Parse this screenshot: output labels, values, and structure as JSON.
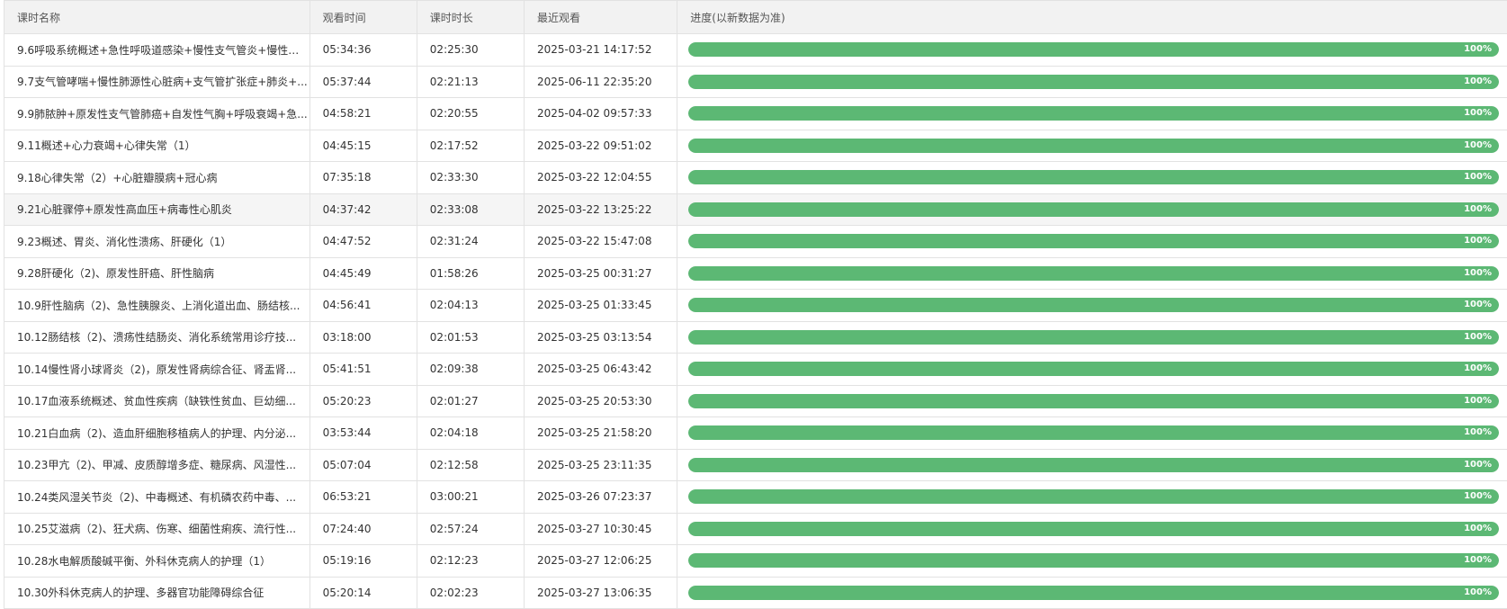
{
  "headers": {
    "name": "课时名称",
    "watch_time": "观看时间",
    "duration": "课时时长",
    "last_watched": "最近观看",
    "progress": "进度(以新数据为准)"
  },
  "colors": {
    "progress_fill": "#5cb874"
  },
  "rows": [
    {
      "name": "9.6呼吸系统概述+急性呼吸道感染+慢性支气管炎+慢性阻...",
      "watch_time": "05:34:36",
      "duration": "02:25:30",
      "last_watched": "2025-03-21 14:17:52",
      "progress": 100,
      "progress_label": "100%"
    },
    {
      "name": "9.7支气管哮喘+慢性肺源性心脏病+支气管扩张症+肺炎+...",
      "watch_time": "05:37:44",
      "duration": "02:21:13",
      "last_watched": "2025-06-11 22:35:20",
      "progress": 100,
      "progress_label": "100%"
    },
    {
      "name": "9.9肺脓肿+原发性支气管肺癌+自发性气胸+呼吸衰竭+急...",
      "watch_time": "04:58:21",
      "duration": "02:20:55",
      "last_watched": "2025-04-02 09:57:33",
      "progress": 100,
      "progress_label": "100%"
    },
    {
      "name": "9.11概述+心力衰竭+心律失常（1）",
      "watch_time": "04:45:15",
      "duration": "02:17:52",
      "last_watched": "2025-03-22 09:51:02",
      "progress": 100,
      "progress_label": "100%"
    },
    {
      "name": "9.18心律失常（2）+心脏瓣膜病+冠心病",
      "watch_time": "07:35:18",
      "duration": "02:33:30",
      "last_watched": "2025-03-22 12:04:55",
      "progress": 100,
      "progress_label": "100%"
    },
    {
      "name": "9.21心脏骤停+原发性高血压+病毒性心肌炎",
      "watch_time": "04:37:42",
      "duration": "02:33:08",
      "last_watched": "2025-03-22 13:25:22",
      "progress": 100,
      "progress_label": "100%"
    },
    {
      "name": "9.23概述、胃炎、消化性溃疡、肝硬化（1）",
      "watch_time": "04:47:52",
      "duration": "02:31:24",
      "last_watched": "2025-03-22 15:47:08",
      "progress": 100,
      "progress_label": "100%"
    },
    {
      "name": "9.28肝硬化（2)、原发性肝癌、肝性脑病",
      "watch_time": "04:45:49",
      "duration": "01:58:26",
      "last_watched": "2025-03-25 00:31:27",
      "progress": 100,
      "progress_label": "100%"
    },
    {
      "name": "10.9肝性脑病（2)、急性胰腺炎、上消化道出血、肠结核...",
      "watch_time": "04:56:41",
      "duration": "02:04:13",
      "last_watched": "2025-03-25 01:33:45",
      "progress": 100,
      "progress_label": "100%"
    },
    {
      "name": "10.12肠结核（2)、溃疡性结肠炎、消化系统常用诊疗技...",
      "watch_time": "03:18:00",
      "duration": "02:01:53",
      "last_watched": "2025-03-25 03:13:54",
      "progress": 100,
      "progress_label": "100%"
    },
    {
      "name": "10.14慢性肾小球肾炎（2)，原发性肾病综合征、肾盂肾...",
      "watch_time": "05:41:51",
      "duration": "02:09:38",
      "last_watched": "2025-03-25 06:43:42",
      "progress": 100,
      "progress_label": "100%"
    },
    {
      "name": "10.17血液系统概述、贫血性疾病（缺铁性贫血、巨幼细...",
      "watch_time": "05:20:23",
      "duration": "02:01:27",
      "last_watched": "2025-03-25 20:53:30",
      "progress": 100,
      "progress_label": "100%"
    },
    {
      "name": "10.21白血病（2)、造血肝细胞移植病人的护理、内分泌...",
      "watch_time": "03:53:44",
      "duration": "02:04:18",
      "last_watched": "2025-03-25 21:58:20",
      "progress": 100,
      "progress_label": "100%"
    },
    {
      "name": "10.23甲亢（2)、甲减、皮质醇增多症、糖尿病、风湿性...",
      "watch_time": "05:07:04",
      "duration": "02:12:58",
      "last_watched": "2025-03-25 23:11:35",
      "progress": 100,
      "progress_label": "100%"
    },
    {
      "name": "10.24类风湿关节炎（2)、中毒概述、有机磷农药中毒、...",
      "watch_time": "06:53:21",
      "duration": "03:00:21",
      "last_watched": "2025-03-26 07:23:37",
      "progress": 100,
      "progress_label": "100%"
    },
    {
      "name": "10.25艾滋病（2)、狂犬病、伤寒、细菌性痢疾、流行性...",
      "watch_time": "07:24:40",
      "duration": "02:57:24",
      "last_watched": "2025-03-27 10:30:45",
      "progress": 100,
      "progress_label": "100%"
    },
    {
      "name": "10.28水电解质酸碱平衡、外科休克病人的护理（1）",
      "watch_time": "05:19:16",
      "duration": "02:12:23",
      "last_watched": "2025-03-27 12:06:25",
      "progress": 100,
      "progress_label": "100%"
    },
    {
      "name": "10.30外科休克病人的护理、多器官功能障碍综合征",
      "watch_time": "05:20:14",
      "duration": "02:02:23",
      "last_watched": "2025-03-27 13:06:35",
      "progress": 100,
      "progress_label": "100%"
    }
  ]
}
